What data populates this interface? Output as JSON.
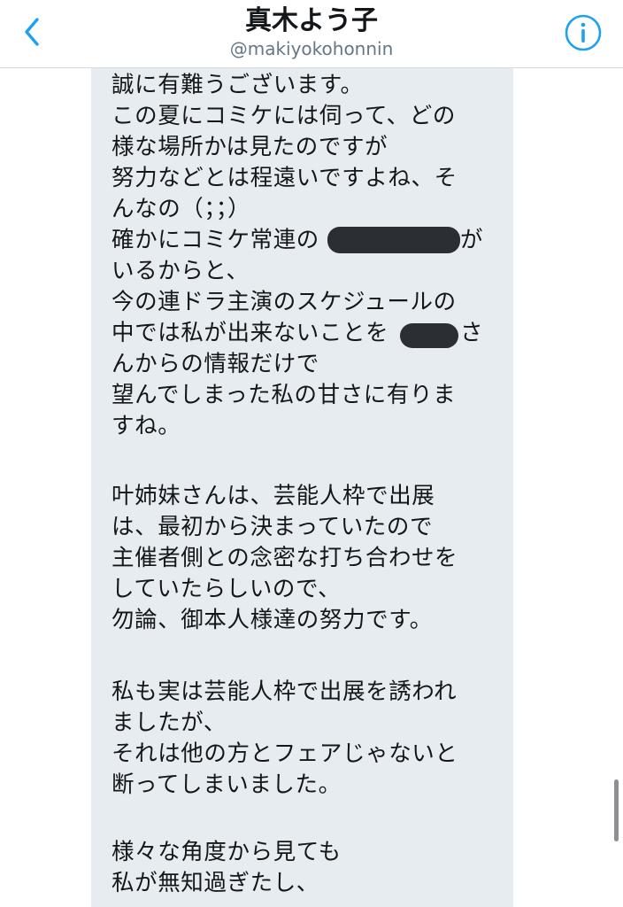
{
  "header": {
    "title": "真木よう子",
    "handle": "@makiyokohonnin",
    "back_icon": "chevron-left-icon",
    "info_icon": "info-circle-icon",
    "accent_color": "#1da1f2"
  },
  "message": {
    "lines": [
      "誠に有難うございます。",
      "この夏にコミケには伺って、どの",
      "様な場所かは見たのですが",
      "努力などとは程遠いですよね、そ",
      "んなの（；；）",
      "確かにコミケ常連の",
      "いるからと、",
      "今の連ドラ主演のスケジュールの",
      "中では私が出来ないことを",
      "んからの情報だけで",
      "望んでしまった私の甘さに有りま",
      "すね。",
      "",
      "叶姉妹さんは、芸能人枠で出展",
      "は、最初から決まっていたので",
      "主催者側との念密な打ち合わせを",
      "していたらしいので、",
      "勿論、御本人様達の努力です。",
      "",
      "私も実は芸能人枠で出展を誘われ",
      "ましたが、",
      "それは他の方とフェアじゃないと",
      "断ってしまいました。",
      "",
      "様々な角度から見ても",
      "私が無知過ぎたし、"
    ],
    "line5_tail": "が",
    "line8_tail": "さ"
  }
}
